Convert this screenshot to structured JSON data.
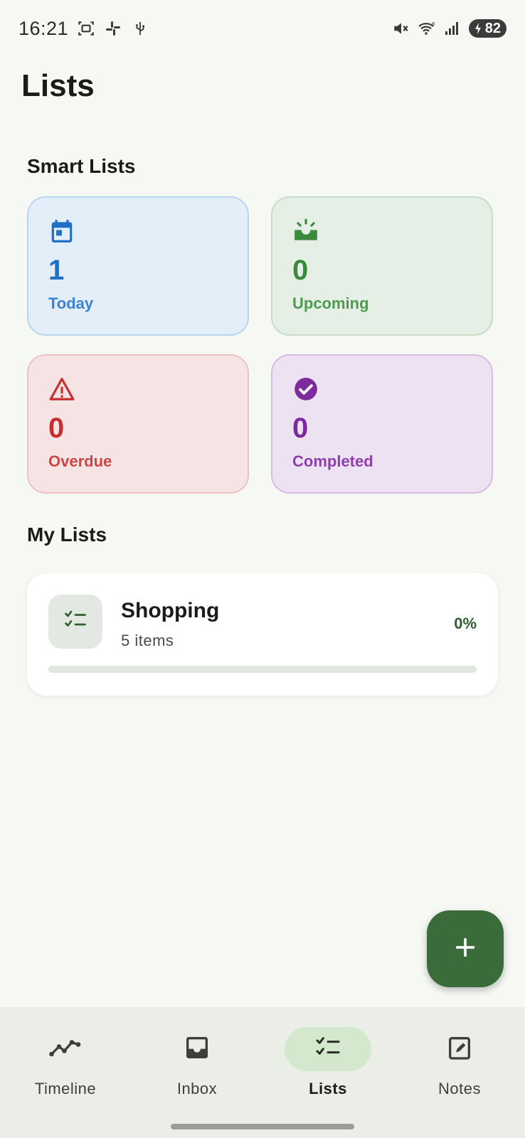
{
  "status_bar": {
    "time": "16:21",
    "battery": "82",
    "left_icons": [
      "screenshot-icon",
      "slack-icon",
      "usb-icon"
    ],
    "right_icons": [
      "mute-icon",
      "wifi-icon",
      "signal-icon",
      "battery-icon"
    ]
  },
  "header": {
    "title": "Lists"
  },
  "smart_lists": {
    "title": "Smart Lists",
    "items": [
      {
        "label": "Today",
        "count": "1",
        "icon": "calendar-icon",
        "color": "#1f6fc5"
      },
      {
        "label": "Upcoming",
        "count": "0",
        "icon": "sunrise-icon",
        "color": "#3a8a3d"
      },
      {
        "label": "Overdue",
        "count": "0",
        "icon": "warning-icon",
        "color": "#c62f2f"
      },
      {
        "label": "Completed",
        "count": "0",
        "icon": "check-circle-icon",
        "color": "#7d2a9e"
      }
    ]
  },
  "my_lists": {
    "title": "My Lists",
    "items": [
      {
        "name": "Shopping",
        "count_text": "5 items",
        "percent_text": "0%",
        "progress": 0,
        "icon": "checklist-icon"
      }
    ]
  },
  "fab": {
    "icon": "plus-icon"
  },
  "bottom_nav": {
    "items": [
      {
        "label": "Timeline",
        "icon": "timeline-icon",
        "active": false
      },
      {
        "label": "Inbox",
        "icon": "inbox-icon",
        "active": false
      },
      {
        "label": "Lists",
        "icon": "checklist-icon",
        "active": true
      },
      {
        "label": "Notes",
        "icon": "notes-icon",
        "active": false
      }
    ]
  },
  "colors": {
    "accent": "#3a6b3a",
    "background": "#f6f8f4"
  }
}
